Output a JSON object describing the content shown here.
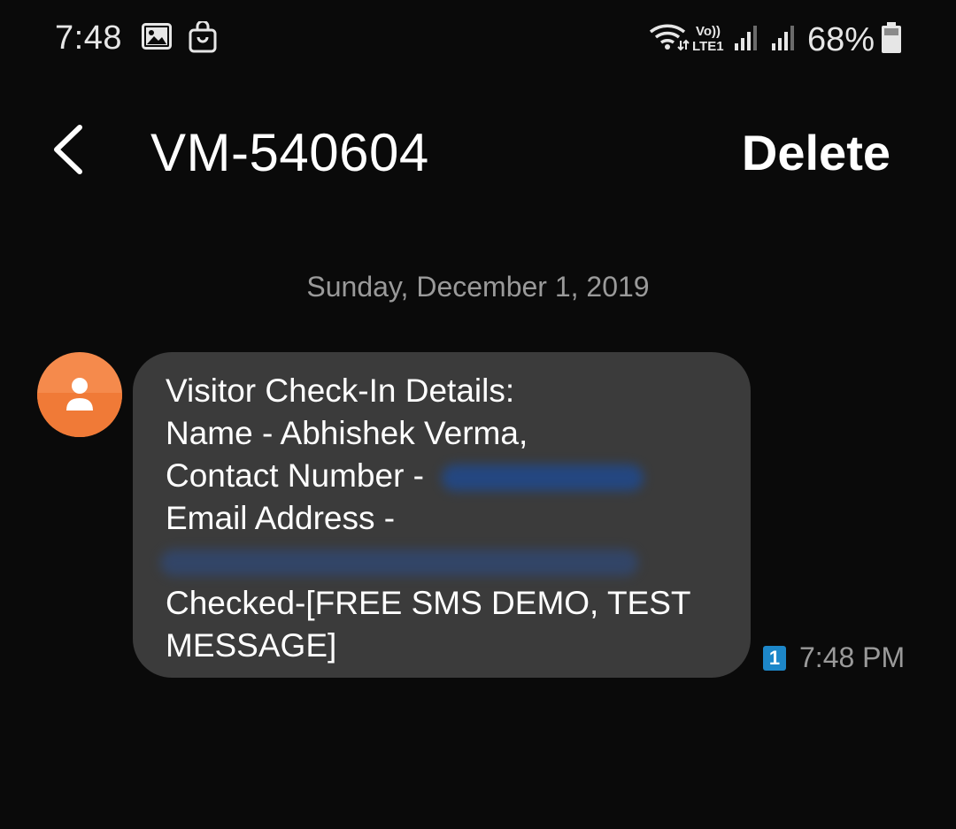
{
  "status_bar": {
    "time": "7:48",
    "battery_percent": "68%",
    "network_label_top": "Vo))",
    "network_label_bottom": "LTE1",
    "icons": [
      "gallery-icon",
      "bag-icon",
      "wifi-icon",
      "volte-icon",
      "signal-icon",
      "signal-icon",
      "battery-icon"
    ]
  },
  "header": {
    "back_icon": "chevron-left-icon",
    "title": "VM-540604",
    "delete_label": "Delete"
  },
  "conversation": {
    "date": "Sunday, December 1, 2019",
    "message": {
      "lines": [
        "Visitor Check-In Details:",
        "Name - Abhishek Verma,",
        "Contact Number - ",
        "Email Address -",
        "",
        "Checked-[FREE SMS DEMO, TEST",
        "MESSAGE]"
      ],
      "sim_slot": "1",
      "time": "7:48 PM"
    }
  },
  "colors": {
    "background": "#0a0a0a",
    "bubble": "#3b3b3b",
    "avatar": "#f58a4c",
    "sim_badge": "#1d87c9",
    "secondary_text": "#9a9a9a"
  }
}
